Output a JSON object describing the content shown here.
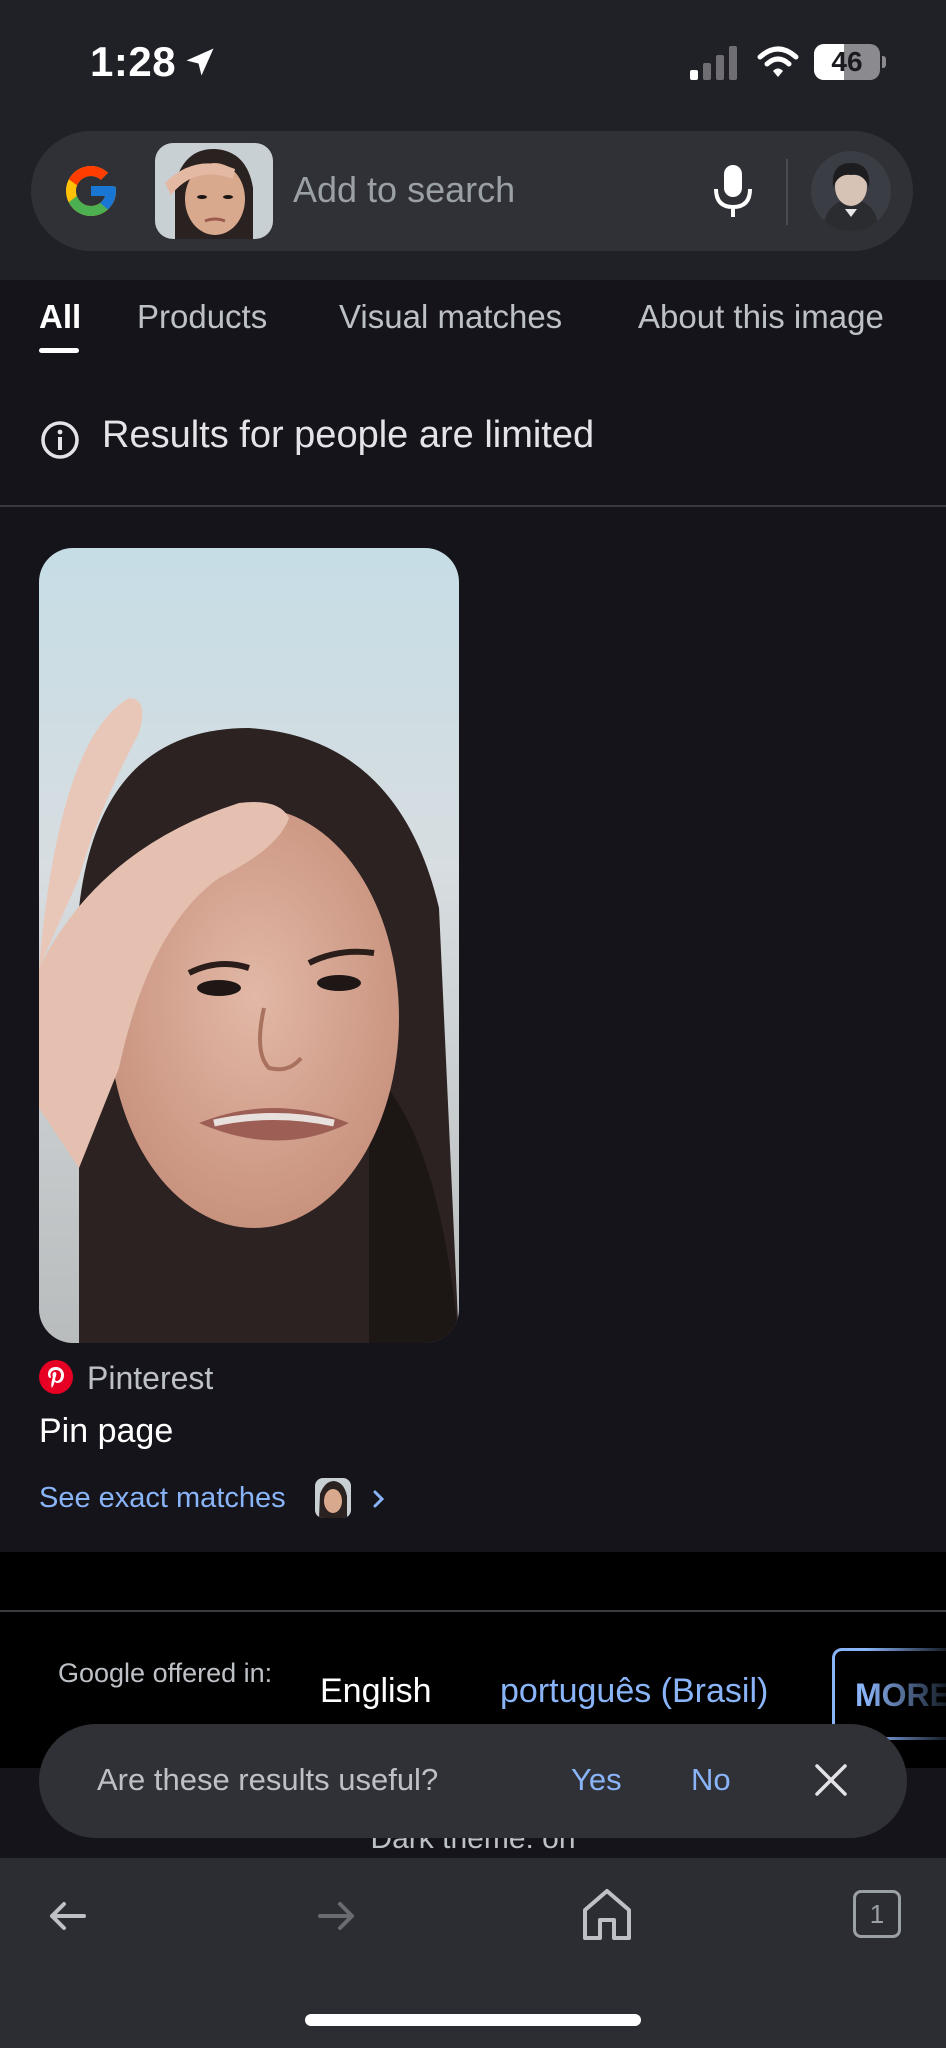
{
  "status_bar": {
    "time": "1:28",
    "battery": "46",
    "battery_level": 0.46
  },
  "search": {
    "placeholder": "Add to search"
  },
  "tabs": [
    {
      "label": "All",
      "active": true
    },
    {
      "label": "Products",
      "active": false
    },
    {
      "label": "Visual matches",
      "active": false
    },
    {
      "label": "About this image",
      "active": false
    }
  ],
  "notice": {
    "text": "Results for people are limited"
  },
  "result": {
    "source": "Pinterest",
    "title": "Pin page",
    "exact_matches_label": "See exact matches"
  },
  "language": {
    "offered_label": "Google offered in:",
    "options": [
      "English",
      "português (Brasil)"
    ],
    "more_label": "MORE"
  },
  "footer": {
    "dark_theme": "Dark theme: on"
  },
  "feedback": {
    "question": "Are these results useful?",
    "yes": "Yes",
    "no": "No"
  },
  "nav": {
    "tab_count": "1"
  },
  "colors": {
    "accent": "#8ab4f8",
    "background": "#14141a",
    "surface": "#303137",
    "pinterest": "#e60023"
  },
  "icons": [
    "location-arrow-icon",
    "cellular-signal-icon",
    "wifi-icon",
    "google-logo-icon",
    "microphone-icon",
    "info-icon",
    "pinterest-icon",
    "chevron-right-icon",
    "close-icon",
    "back-arrow-icon",
    "forward-arrow-icon",
    "home-icon",
    "tabs-icon"
  ]
}
